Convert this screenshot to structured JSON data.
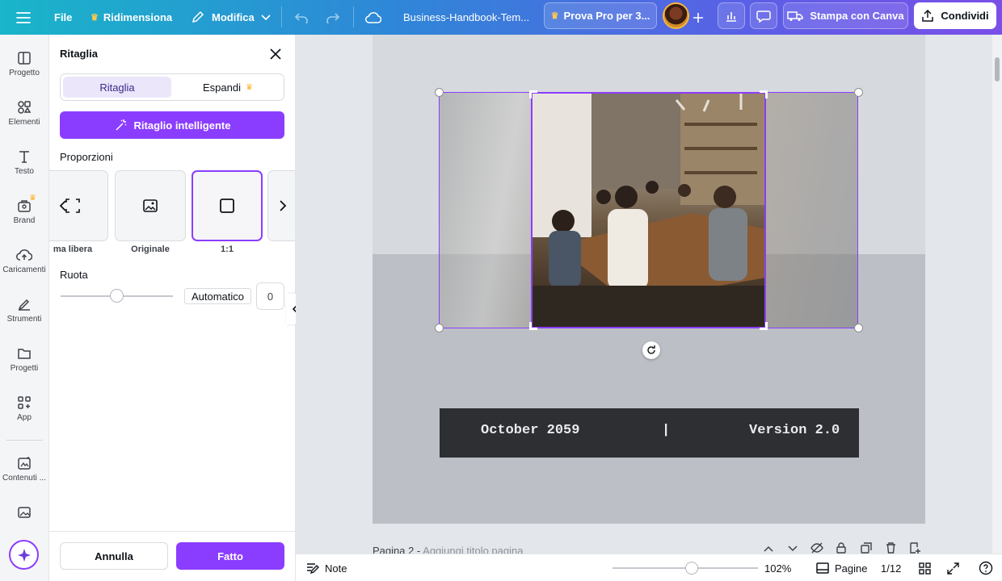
{
  "topbar": {
    "menu_icon": "hamburger-menu-icon",
    "file": "File",
    "resize": "Ridimensiona",
    "edit": "Modifica",
    "doc_title": "Business-Handbook-Tem...",
    "try_pro": "Prova Pro per 3...",
    "print": "Stampa con Canva",
    "share": "Condividi"
  },
  "rail": {
    "items": [
      {
        "label": "Progetto",
        "icon": "layout-icon"
      },
      {
        "label": "Elementi",
        "icon": "shapes-icon"
      },
      {
        "label": "Testo",
        "icon": "text-icon"
      },
      {
        "label": "Brand",
        "icon": "brand-icon"
      },
      {
        "label": "Caricamenti",
        "icon": "upload-cloud-icon"
      },
      {
        "label": "Strumenti",
        "icon": "draw-icon"
      },
      {
        "label": "Progetti",
        "icon": "folder-icon"
      },
      {
        "label": "App",
        "icon": "apps-icon"
      },
      {
        "label": "Contenuti ...",
        "icon": "magic-media-icon"
      }
    ]
  },
  "panel": {
    "title": "Ritaglia",
    "tab_crop": "Ritaglia",
    "tab_expand": "Espandi",
    "smart_crop": "Ritaglio intelligente",
    "ratios_label": "Proporzioni",
    "ratios": [
      {
        "label": "Forma libera",
        "visible": "ma libera"
      },
      {
        "label": "Originale"
      },
      {
        "label": "1:1",
        "selected": true
      }
    ],
    "rotate_label": "Ruota",
    "rotate_auto": "Automatico",
    "rotate_value": "0",
    "cancel": "Annulla",
    "done": "Fatto"
  },
  "canvas": {
    "date_text": "October 2059",
    "separator": "|",
    "version_text": "Version 2.0",
    "page_label": "Pagina 2 - ",
    "page_title_placeholder": "Aggiungi titolo pagina"
  },
  "bottombar": {
    "notes": "Note",
    "zoom": "102%",
    "pages": "Pagine",
    "page_count": "1/12"
  },
  "colors": {
    "accent": "#8b3dff",
    "header_gradient_start": "#19b5c9",
    "header_gradient_end": "#7a4fe8"
  }
}
